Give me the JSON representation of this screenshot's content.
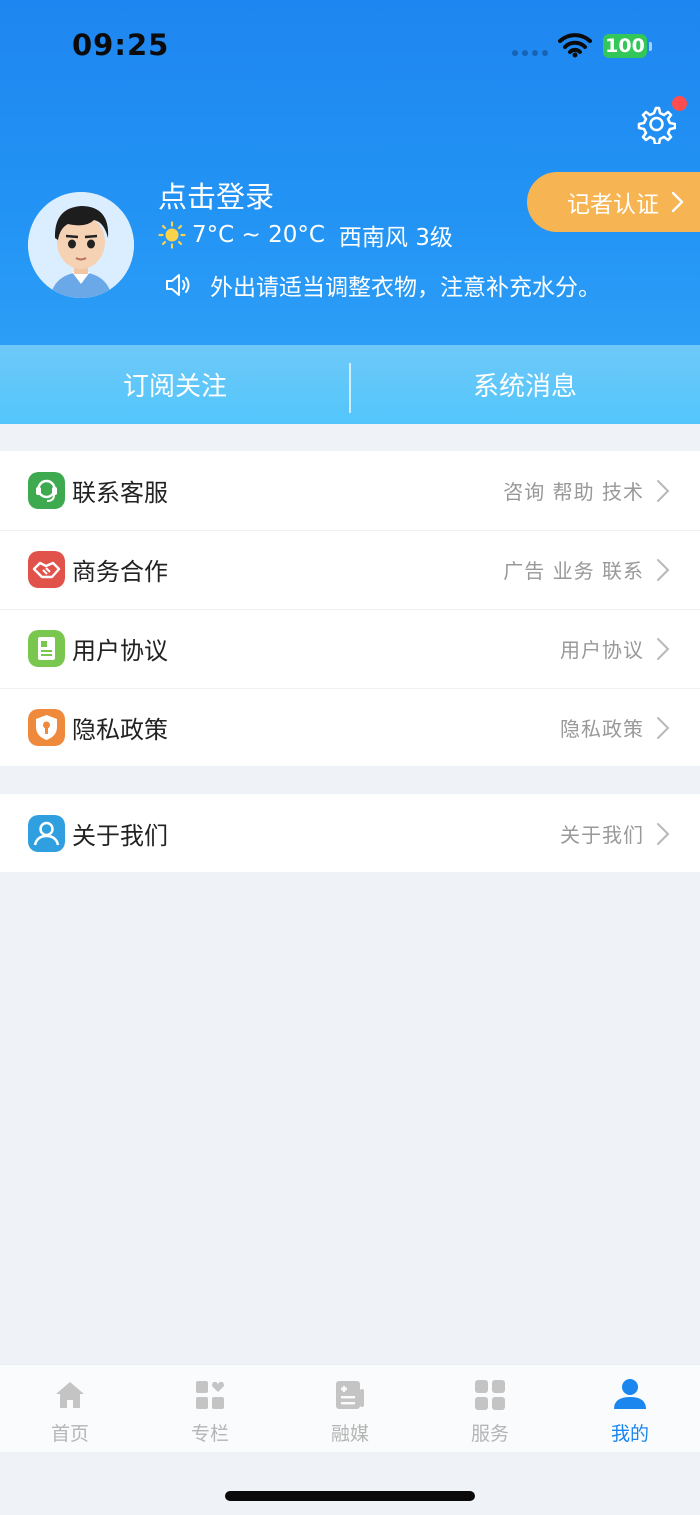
{
  "status_bar": {
    "time": "09:25",
    "battery": "100"
  },
  "profile": {
    "login_text": "点击登录",
    "weather_temp": "7°C ~ 20°C",
    "weather_wind": "西南风 3级",
    "tip": "外出请适当调整衣物，注意补充水分。",
    "reporter_button": "记者认证"
  },
  "tabs": [
    {
      "label": "订阅关注"
    },
    {
      "label": "系统消息"
    }
  ],
  "menu_group_1": [
    {
      "label": "联系客服",
      "sub": "咨询 帮助 技术",
      "icon": "headset-icon",
      "color": "#3daa4f"
    },
    {
      "label": "商务合作",
      "sub": "广告 业务 联系",
      "icon": "handshake-icon",
      "color": "#e0524a"
    },
    {
      "label": "用户协议",
      "sub": "用户协议",
      "icon": "document-icon",
      "color": "#7ac74f"
    },
    {
      "label": "隐私政策",
      "sub": "隐私政策",
      "icon": "shield-icon",
      "color": "#ef8a3c"
    }
  ],
  "menu_group_2": [
    {
      "label": "关于我们",
      "sub": "关于我们",
      "icon": "user-icon",
      "color": "#2f9fe0"
    }
  ],
  "tabbar": [
    {
      "label": "首页",
      "icon": "home-icon",
      "active": false
    },
    {
      "label": "专栏",
      "icon": "columns-icon",
      "active": false
    },
    {
      "label": "融媒",
      "icon": "news-icon",
      "active": false
    },
    {
      "label": "服务",
      "icon": "grid-icon",
      "active": false
    },
    {
      "label": "我的",
      "icon": "profile-icon",
      "active": true
    }
  ],
  "colors": {
    "brand_blue": "#1a86ee",
    "accent_orange": "#f6b452",
    "badge_red": "#ff4d4f"
  }
}
